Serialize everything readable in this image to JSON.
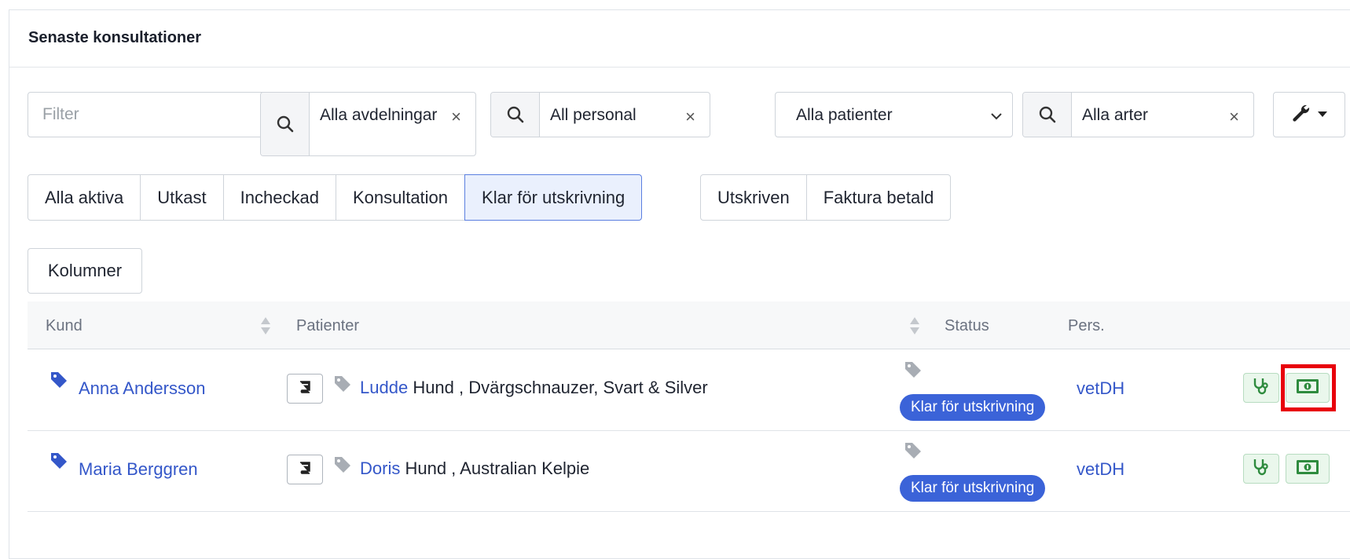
{
  "card": {
    "title": "Senaste konsultationer"
  },
  "filters": {
    "text_placeholder": "Filter",
    "department": "Alla avdelningar",
    "staff": "All personal",
    "patients": "Alla patienter",
    "species": "Alla arter",
    "clear_symbol": "×"
  },
  "tabs": [
    {
      "label": "Alla aktiva"
    },
    {
      "label": "Utkast"
    },
    {
      "label": "Incheckad"
    },
    {
      "label": "Konsultation"
    },
    {
      "label": "Klar för utskrivning",
      "active": true
    }
  ],
  "tabs2": [
    {
      "label": "Utskriven"
    },
    {
      "label": "Faktura betald"
    }
  ],
  "columns_button": "Kolumner",
  "table": {
    "headers": {
      "kund": "Kund",
      "patienter": "Patienter",
      "status": "Status",
      "pers": "Pers."
    },
    "rows": [
      {
        "customer": "Anna Andersson",
        "patient_name": "Ludde",
        "patient_details": "Hund , Dvärgschnauzer, Svart & Silver",
        "status": "Klar för utskrivning",
        "staff": "vetDH"
      },
      {
        "customer": "Maria Berggren",
        "patient_name": "Doris",
        "patient_details": "Hund , Australian Kelpie",
        "status": "Klar för utskrivning",
        "staff": "vetDH"
      }
    ]
  },
  "colors": {
    "link": "#3457c9",
    "badge": "#3b63d8",
    "action_green": "#2e8b3e",
    "highlight": "#e8000b"
  },
  "icons": [
    "search-icon",
    "chevron-down-icon",
    "wrench-icon",
    "caret-down-icon",
    "tag-icon",
    "book-icon",
    "stethoscope-icon",
    "money-icon",
    "sort-icon"
  ]
}
